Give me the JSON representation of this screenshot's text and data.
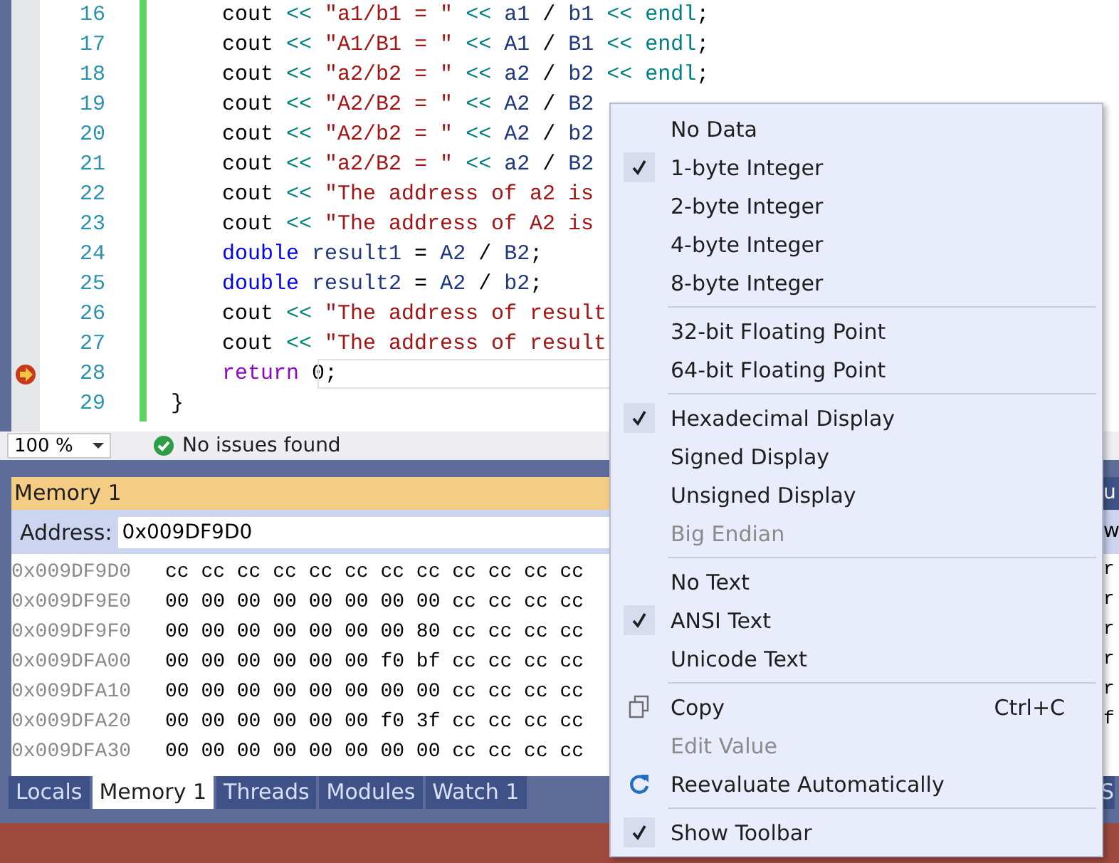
{
  "editor": {
    "lines": [
      {
        "number": "16",
        "current": false,
        "tokens": [
          {
            "kind": "plain",
            "text": "    cout "
          },
          {
            "kind": "op",
            "text": "<< "
          },
          {
            "kind": "str",
            "text": "\"a1/b1 = \" "
          },
          {
            "kind": "op",
            "text": "<< "
          },
          {
            "kind": "var",
            "text": "a1 "
          },
          {
            "kind": "plain",
            "text": "/ "
          },
          {
            "kind": "var",
            "text": "b1 "
          },
          {
            "kind": "op",
            "text": "<< endl"
          },
          {
            "kind": "plain",
            "text": ";"
          }
        ]
      },
      {
        "number": "17",
        "current": false,
        "tokens": [
          {
            "kind": "plain",
            "text": "    cout "
          },
          {
            "kind": "op",
            "text": "<< "
          },
          {
            "kind": "str",
            "text": "\"A1/B1 = \" "
          },
          {
            "kind": "op",
            "text": "<< "
          },
          {
            "kind": "var",
            "text": "A1 "
          },
          {
            "kind": "plain",
            "text": "/ "
          },
          {
            "kind": "var",
            "text": "B1 "
          },
          {
            "kind": "op",
            "text": "<< endl"
          },
          {
            "kind": "plain",
            "text": ";"
          }
        ]
      },
      {
        "number": "18",
        "current": false,
        "tokens": [
          {
            "kind": "plain",
            "text": "    cout "
          },
          {
            "kind": "op",
            "text": "<< "
          },
          {
            "kind": "str",
            "text": "\"a2/b2 = \" "
          },
          {
            "kind": "op",
            "text": "<< "
          },
          {
            "kind": "var",
            "text": "a2 "
          },
          {
            "kind": "plain",
            "text": "/ "
          },
          {
            "kind": "var",
            "text": "b2 "
          },
          {
            "kind": "op",
            "text": "<< endl"
          },
          {
            "kind": "plain",
            "text": ";"
          }
        ]
      },
      {
        "number": "19",
        "current": false,
        "tokens": [
          {
            "kind": "plain",
            "text": "    cout "
          },
          {
            "kind": "op",
            "text": "<< "
          },
          {
            "kind": "str",
            "text": "\"A2/B2 = \" "
          },
          {
            "kind": "op",
            "text": "<< "
          },
          {
            "kind": "var",
            "text": "A2 "
          },
          {
            "kind": "plain",
            "text": "/ "
          },
          {
            "kind": "var",
            "text": "B2"
          }
        ]
      },
      {
        "number": "20",
        "current": false,
        "tokens": [
          {
            "kind": "plain",
            "text": "    cout "
          },
          {
            "kind": "op",
            "text": "<< "
          },
          {
            "kind": "str",
            "text": "\"A2/b2 = \" "
          },
          {
            "kind": "op",
            "text": "<< "
          },
          {
            "kind": "var",
            "text": "A2 "
          },
          {
            "kind": "plain",
            "text": "/ "
          },
          {
            "kind": "var",
            "text": "b2"
          }
        ]
      },
      {
        "number": "21",
        "current": false,
        "tokens": [
          {
            "kind": "plain",
            "text": "    cout "
          },
          {
            "kind": "op",
            "text": "<< "
          },
          {
            "kind": "str",
            "text": "\"a2/B2 = \" "
          },
          {
            "kind": "op",
            "text": "<< "
          },
          {
            "kind": "var",
            "text": "a2 "
          },
          {
            "kind": "plain",
            "text": "/ "
          },
          {
            "kind": "var",
            "text": "B2"
          }
        ]
      },
      {
        "number": "22",
        "current": false,
        "tokens": [
          {
            "kind": "plain",
            "text": "    cout "
          },
          {
            "kind": "op",
            "text": "<< "
          },
          {
            "kind": "str",
            "text": "\"The address of a2 is"
          }
        ]
      },
      {
        "number": "23",
        "current": false,
        "tokens": [
          {
            "kind": "plain",
            "text": "    cout "
          },
          {
            "kind": "op",
            "text": "<< "
          },
          {
            "kind": "str",
            "text": "\"The address of A2 is"
          }
        ]
      },
      {
        "number": "24",
        "current": false,
        "tokens": [
          {
            "kind": "kw",
            "text": "    double "
          },
          {
            "kind": "var",
            "text": "result1 "
          },
          {
            "kind": "plain",
            "text": "= "
          },
          {
            "kind": "var",
            "text": "A2 "
          },
          {
            "kind": "plain",
            "text": "/ "
          },
          {
            "kind": "var",
            "text": "B2"
          },
          {
            "kind": "plain",
            "text": ";"
          }
        ]
      },
      {
        "number": "25",
        "current": false,
        "tokens": [
          {
            "kind": "kw",
            "text": "    double "
          },
          {
            "kind": "var",
            "text": "result2 "
          },
          {
            "kind": "plain",
            "text": "= "
          },
          {
            "kind": "var",
            "text": "A2 "
          },
          {
            "kind": "plain",
            "text": "/ "
          },
          {
            "kind": "var",
            "text": "b2"
          },
          {
            "kind": "plain",
            "text": ";"
          }
        ]
      },
      {
        "number": "26",
        "current": false,
        "tokens": [
          {
            "kind": "plain",
            "text": "    cout "
          },
          {
            "kind": "op",
            "text": "<< "
          },
          {
            "kind": "str",
            "text": "\"The address of result"
          }
        ]
      },
      {
        "number": "27",
        "current": false,
        "tokens": [
          {
            "kind": "plain",
            "text": "    cout "
          },
          {
            "kind": "op",
            "text": "<< "
          },
          {
            "kind": "str",
            "text": "\"The address of result"
          }
        ]
      },
      {
        "number": "28",
        "current": true,
        "tokens": [
          {
            "kind": "ctl",
            "text": "    return "
          },
          {
            "kind": "plain",
            "text": "0;"
          }
        ]
      },
      {
        "number": "29",
        "current": false,
        "tokens": [
          {
            "kind": "plain",
            "text": "}"
          }
        ]
      }
    ]
  },
  "status_bar": {
    "zoom": "100 %",
    "issues": "No issues found"
  },
  "memory": {
    "title": "Memory 1",
    "address_label": "Address:",
    "address": "0x009DF9D0",
    "rows": [
      {
        "address": "0x009DF9D0",
        "bytes": "cc cc cc cc cc cc cc cc cc cc cc cc"
      },
      {
        "address": "0x009DF9E0",
        "bytes": "00 00 00 00 00 00 00 00 cc cc cc cc"
      },
      {
        "address": "0x009DF9F0",
        "bytes": "00 00 00 00 00 00 00 80 cc cc cc cc"
      },
      {
        "address": "0x009DFA00",
        "bytes": "00 00 00 00 00 00 f0 bf cc cc cc cc"
      },
      {
        "address": "0x009DFA10",
        "bytes": "00 00 00 00 00 00 00 00 cc cc cc cc"
      },
      {
        "address": "0x009DFA20",
        "bytes": "00 00 00 00 00 00 f0 3f cc cc cc cc"
      },
      {
        "address": "0x009DFA30",
        "bytes": "00 00 00 00 00 00 00 00 cc cc cc cc"
      }
    ]
  },
  "tabs": [
    {
      "label": "Locals",
      "selected": false
    },
    {
      "label": "Memory 1",
      "selected": true
    },
    {
      "label": "Threads",
      "selected": false
    },
    {
      "label": "Modules",
      "selected": false
    },
    {
      "label": "Watch 1",
      "selected": false
    }
  ],
  "right_panel": {
    "title": "u",
    "toolbar": "w",
    "lines": [
      "r",
      "r",
      "r",
      "r",
      "r",
      "f"
    ],
    "tab": "S"
  },
  "context_menu": {
    "groups": [
      [
        {
          "kind": "option",
          "label": "No Data",
          "checked": false,
          "disabled": false
        },
        {
          "kind": "option",
          "label": "1-byte Integer",
          "checked": true,
          "disabled": false
        },
        {
          "kind": "option",
          "label": "2-byte Integer",
          "checked": false,
          "disabled": false
        },
        {
          "kind": "option",
          "label": "4-byte Integer",
          "checked": false,
          "disabled": false
        },
        {
          "kind": "option",
          "label": "8-byte Integer",
          "checked": false,
          "disabled": false
        }
      ],
      [
        {
          "kind": "option",
          "label": "32-bit Floating Point",
          "checked": false,
          "disabled": false
        },
        {
          "kind": "option",
          "label": "64-bit Floating Point",
          "checked": false,
          "disabled": false
        }
      ],
      [
        {
          "kind": "option",
          "label": "Hexadecimal Display",
          "checked": true,
          "disabled": false
        },
        {
          "kind": "option",
          "label": "Signed Display",
          "checked": false,
          "disabled": false
        },
        {
          "kind": "option",
          "label": "Unsigned Display",
          "checked": false,
          "disabled": false
        },
        {
          "kind": "option",
          "label": "Big Endian",
          "checked": false,
          "disabled": true
        }
      ],
      [
        {
          "kind": "option",
          "label": "No Text",
          "checked": false,
          "disabled": false
        },
        {
          "kind": "option",
          "label": "ANSI Text",
          "checked": true,
          "disabled": false
        },
        {
          "kind": "option",
          "label": "Unicode Text",
          "checked": false,
          "disabled": false
        }
      ],
      [
        {
          "kind": "copy",
          "label": "Copy",
          "shortcut": "Ctrl+C",
          "checked": false,
          "disabled": false
        },
        {
          "kind": "option",
          "label": "Edit Value",
          "checked": false,
          "disabled": true
        },
        {
          "kind": "refresh",
          "label": "Reevaluate Automatically",
          "checked": false,
          "disabled": false
        }
      ],
      [
        {
          "kind": "option",
          "label": "Show Toolbar",
          "checked": true,
          "disabled": false
        }
      ]
    ]
  }
}
